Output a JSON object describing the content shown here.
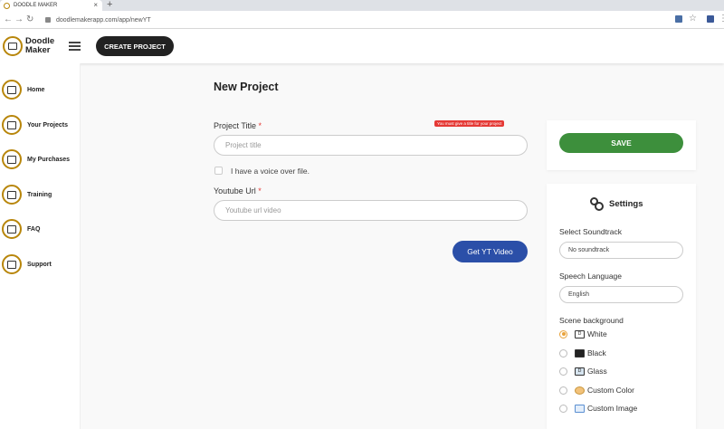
{
  "browser": {
    "tab_title": "DOODLE MAKER",
    "url": "doodlemakerapp.com/app/newYT"
  },
  "header": {
    "logo_line1": "Doodle",
    "logo_line2": "Maker",
    "create_label": "CREATE PROJECT"
  },
  "sidebar": {
    "items": [
      {
        "label": "Home",
        "icon": "document-icon"
      },
      {
        "label": "Your Projects",
        "icon": "folder-icon"
      },
      {
        "label": "My Purchases",
        "icon": "cart-icon"
      },
      {
        "label": "Training",
        "icon": "presentation-icon"
      },
      {
        "label": "FAQ",
        "icon": "pencil-icon"
      },
      {
        "label": "Support",
        "icon": "chat-icon"
      }
    ]
  },
  "form": {
    "title": "New Project",
    "project_title_label": "Project Title",
    "required_mark": "*",
    "error_text": "You must give a title for your project",
    "project_title_placeholder": "Project title",
    "project_title_value": "",
    "voice_over_label": "I have a voice over file.",
    "youtube_label": "Youtube Url",
    "youtube_placeholder": "Youtube url video",
    "youtube_value": "",
    "get_video_label": "Get YT Video"
  },
  "actions": {
    "save_label": "SAVE"
  },
  "settings": {
    "title": "Settings",
    "soundtrack_label": "Select Soundtrack",
    "soundtrack_value": "No soundtrack",
    "language_label": "Speech Language",
    "language_value": "English",
    "background_label": "Scene background",
    "backgrounds": [
      {
        "label": "White",
        "selected": true
      },
      {
        "label": "Black",
        "selected": false
      },
      {
        "label": "Glass",
        "selected": false
      },
      {
        "label": "Custom Color",
        "selected": false
      },
      {
        "label": "Custom Image",
        "selected": false
      }
    ]
  },
  "colors": {
    "brand_gold": "#b8860b",
    "save_green": "#3d8f3c",
    "primary_blue": "#2b4fa8",
    "error_red": "#e53935",
    "radio_selected": "#e8a33c"
  }
}
